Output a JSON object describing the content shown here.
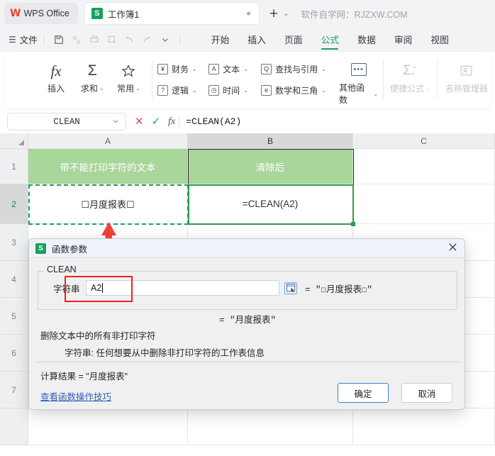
{
  "titlebar": {
    "brand": "WPS Office",
    "brand_logo": "wps-logo",
    "doc_tab": {
      "label": "工作簿1",
      "badge": "S"
    },
    "new_tab": "+",
    "tab_caret": "⌄",
    "promo": "软件自学网：RJZXW.COM"
  },
  "menubar": {
    "hamburger": "☰",
    "file": "文件",
    "quick_access": [
      {
        "name": "save-icon",
        "glyph": "🖫",
        "disabled": false
      },
      {
        "name": "share-icon",
        "glyph": "⚯",
        "disabled": true
      },
      {
        "name": "print-icon",
        "glyph": "🖶",
        "disabled": true
      },
      {
        "name": "print-preview-icon",
        "glyph": "🔍",
        "disabled": true
      },
      {
        "name": "undo-icon",
        "glyph": "↺",
        "disabled": true
      },
      {
        "name": "redo-icon",
        "glyph": "↻",
        "disabled": true
      },
      {
        "name": "customize-caret-icon",
        "glyph": "⌄",
        "disabled": false
      }
    ],
    "tabs": [
      {
        "label": "开始",
        "active": false
      },
      {
        "label": "插入",
        "active": false
      },
      {
        "label": "页面",
        "active": false
      },
      {
        "label": "公式",
        "active": true
      },
      {
        "label": "数据",
        "active": false
      },
      {
        "label": "审阅",
        "active": false
      },
      {
        "label": "视图",
        "active": false
      }
    ]
  },
  "ribbon": {
    "insert_fn": {
      "icon": "fx",
      "label": "插入"
    },
    "autosum": {
      "icon": "Σ",
      "label": "求和",
      "caret": "⌄"
    },
    "common": {
      "icon": "☆",
      "label": "常用",
      "caret": "⌄"
    },
    "categories": [
      {
        "box": "¥",
        "label": "财务",
        "caret": "⌄",
        "name": "financial"
      },
      {
        "box": "?",
        "label": "逻辑",
        "caret": "⌄",
        "name": "logical"
      },
      {
        "box": "A",
        "label": "文本",
        "caret": "⌄",
        "name": "text"
      },
      {
        "box": "◷",
        "label": "时间",
        "caret": "⌄",
        "name": "datetime"
      },
      {
        "box": "Q",
        "label": "查找与引用",
        "caret": "⌄",
        "name": "lookup"
      },
      {
        "box": "e",
        "label": "数学和三角",
        "caret": "⌄",
        "name": "math"
      }
    ],
    "other_fn": {
      "label": "其他函数",
      "caret": "⌄"
    },
    "quick_formula": {
      "icon": "Σ",
      "label": "便捷公式",
      "caret": "⌄"
    },
    "name_manager": {
      "label": "名称管理器"
    }
  },
  "formulabar": {
    "namebox_value": "CLEAN",
    "namebox_caret": "⌄",
    "cancel_glyph": "✕",
    "confirm_glyph": "✓",
    "fx_glyph": "fx",
    "formula": "=CLEAN(A2)"
  },
  "grid": {
    "columns": [
      "A",
      "B",
      "C"
    ],
    "selected_column": "B",
    "rows": [
      "1",
      "2",
      "3",
      "4",
      "5",
      "6",
      "7"
    ],
    "selected_row": "2",
    "cells": {
      "A1": "带不能打印字符的文本",
      "B1": "清除后",
      "A2": "☐月度报表☐",
      "B2": "=CLEAN(A2)"
    },
    "header_fill": "#a9d69a",
    "marching_ants_color": "#1aa06a",
    "selection_color": "#2e9b4e"
  },
  "annotation": {
    "arrow_color": "#f3403a",
    "highlight_box_color": "#ee2222"
  },
  "dialog": {
    "badge": "S",
    "title": "函数参数",
    "close_glyph": "✕",
    "fn_name": "CLEAN",
    "arg_label": "字符串",
    "arg_value": "A2",
    "range_picker_icon": "range-picker",
    "arg_result": "=  \"☐月度报表☐\"",
    "fn_result_line": "=  \"月度报表\"",
    "description": "删除文本中的所有非打印字符",
    "arg_description": "字符串:  任何想要从中删除非打印字符的工作表信息",
    "calc_result": "计算结果  =  \"月度报表\"",
    "tip_link": "查看函数操作技巧",
    "ok_button": "确定",
    "cancel_button": "取消"
  }
}
